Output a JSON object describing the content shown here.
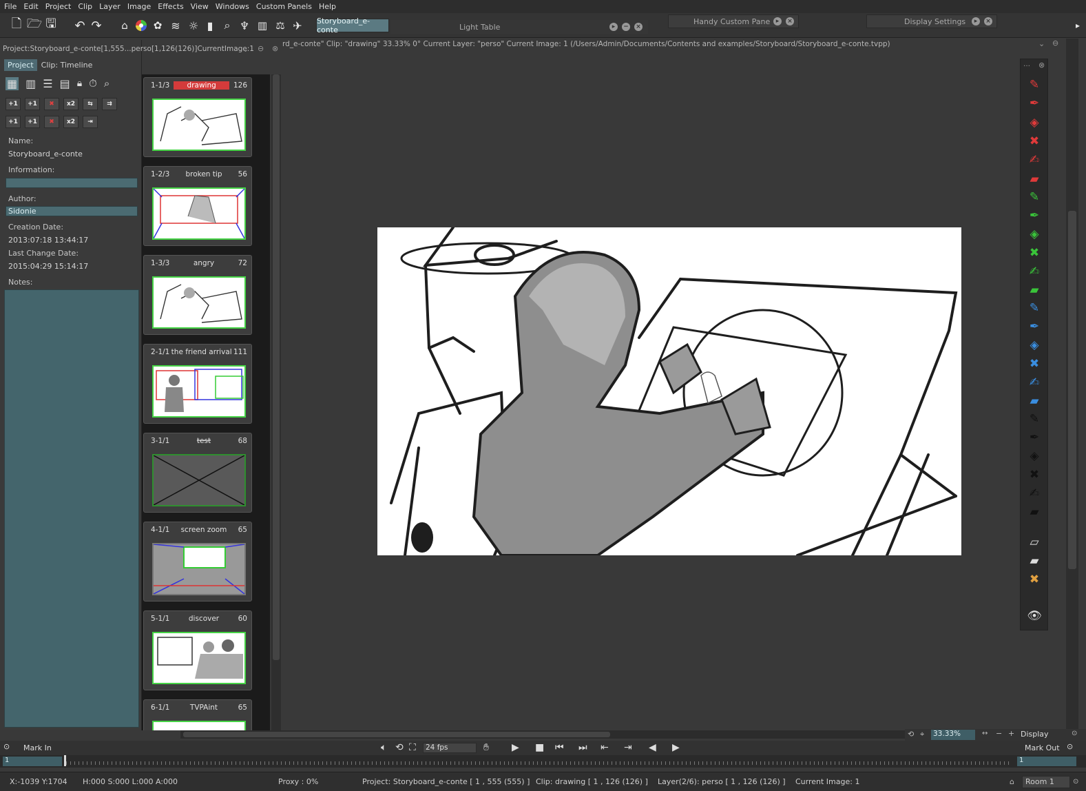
{
  "menu": [
    "File",
    "Edit",
    "Project",
    "Clip",
    "Layer",
    "Image",
    "Effects",
    "View",
    "Windows",
    "Custom Panels",
    "Help"
  ],
  "toolbar": {
    "room_tab": "Storyboard_e-conte",
    "light_table": "Light Table",
    "handy_pane": "Handy Custom Pane",
    "display_settings": "Display Settings"
  },
  "project_panel": {
    "title": "Project:Storyboard_e-conte[1,555...perso[1,126(126)]CurrentImage:1",
    "tab_project": "Project",
    "tab_clip": "Clip: Timeline",
    "name_label": "Name:",
    "name_value": "Storyboard_e-conte",
    "info_label": "Information:",
    "info_value": "",
    "author_label": "Author:",
    "author_value": "Sidonie",
    "creation_label": "Creation Date:",
    "creation_value": "2013:07:18 13:44:17",
    "change_label": "Last Change Date:",
    "change_value": "2015:04:29 15:14:17",
    "notes_label": "Notes:",
    "mini_buttons": [
      "+1",
      "+1",
      "✖",
      "x2",
      "+1",
      "+1",
      "✖",
      "x2"
    ]
  },
  "clips": [
    {
      "index": "1-1/3",
      "name": "drawing",
      "frames": "126",
      "active": true
    },
    {
      "index": "1-2/3",
      "name": "broken tip",
      "frames": "56",
      "active": false
    },
    {
      "index": "1-3/3",
      "name": "angry",
      "frames": "72",
      "active": false
    },
    {
      "index": "2-1/1",
      "name": "the friend arrival",
      "frames": "111",
      "active": false
    },
    {
      "index": "3-1/1",
      "name": "test",
      "frames": "68",
      "active": false
    },
    {
      "index": "4-1/1",
      "name": "screen zoom",
      "frames": "65",
      "active": false
    },
    {
      "index": "5-1/1",
      "name": "discover",
      "frames": "60",
      "active": false
    },
    {
      "index": "6-1/1",
      "name": "TVPAint",
      "frames": "65",
      "active": false
    }
  ],
  "viewport": {
    "info": "rd_e-conte\"  Clip: \"drawing\"   33.33%   0°  Current Layer: \"perso\"  Current Image: 1 (/Users/Admin/Documents/Contents and examples/Storyboard/Storyboard_e-conte.tvpp)"
  },
  "bottom": {
    "zoom": "33.33%",
    "display": "Display",
    "mark_in": "Mark In",
    "mark_out": "Mark Out",
    "fps": "24 fps",
    "timeline_start": "1",
    "timeline_end": "1"
  },
  "status": {
    "coords": "X:-1039  Y:1704",
    "hsl": "H:000 S:000 L:000 A:000",
    "proxy": "Proxy : 0%",
    "project": "Project: Storyboard_e-conte [ 1 , 555  (555) ]",
    "clip": "Clip: drawing [ 1 , 126  (126) ]",
    "layer": "Layer(2/6): perso [ 1 , 126  (126) ]",
    "current_image": "Current Image: 1",
    "room": "Room 1"
  }
}
